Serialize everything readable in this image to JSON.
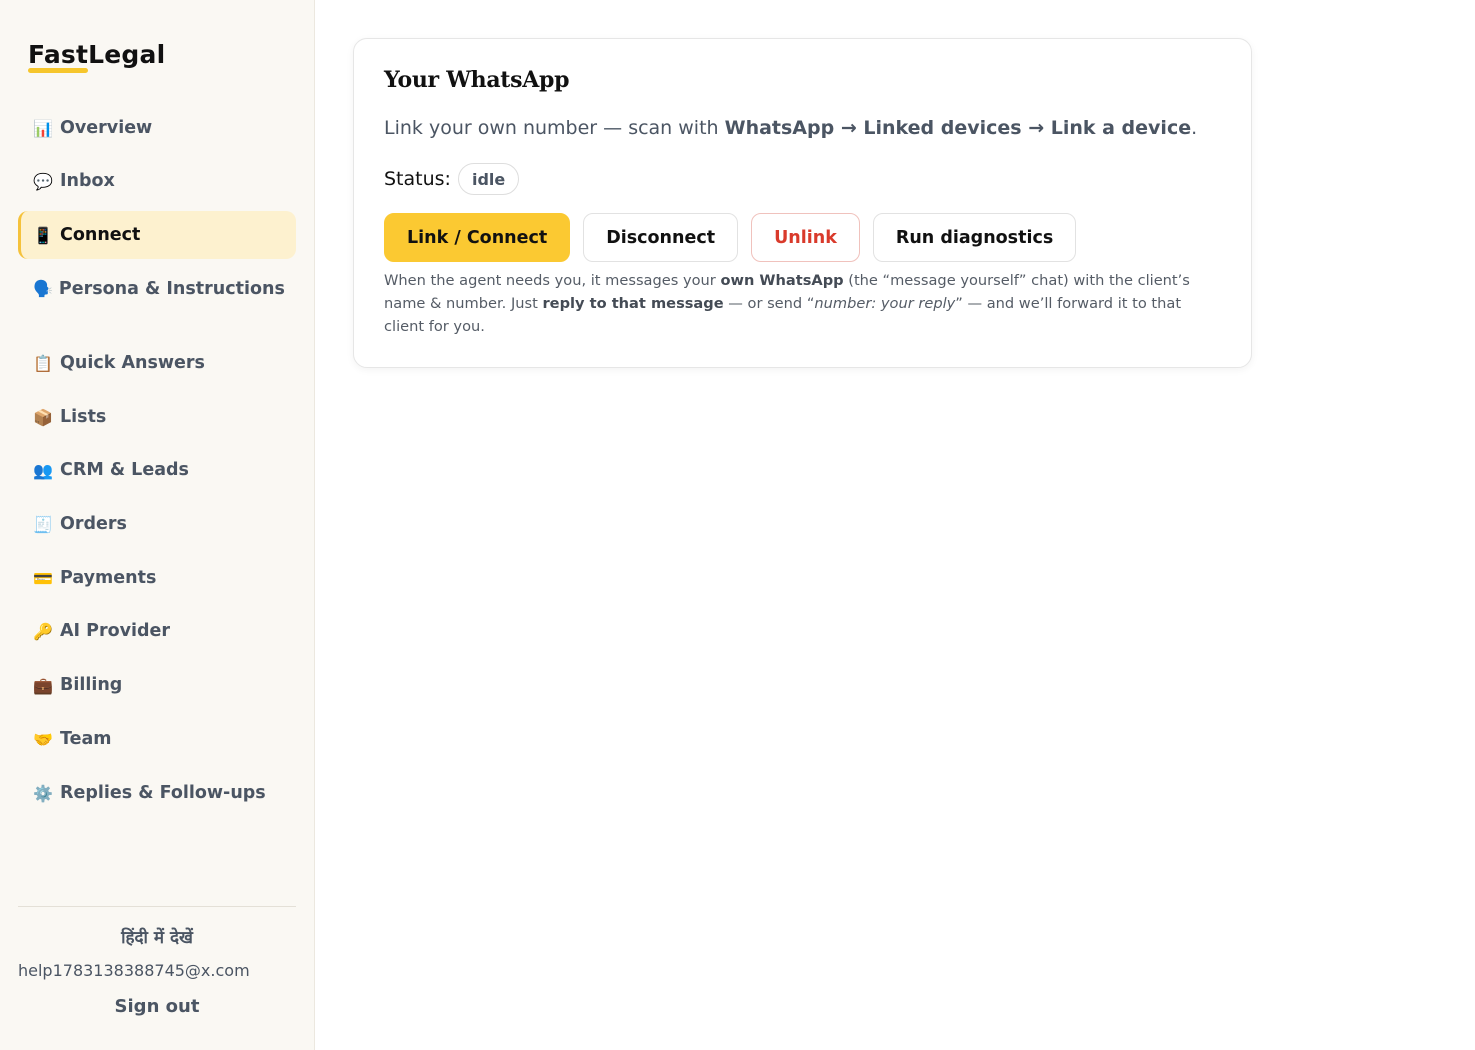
{
  "brand": {
    "name": "FastLegal"
  },
  "sidebar": {
    "items": [
      {
        "icon": "📊",
        "icon_name": "bar-chart-icon",
        "label": "Overview"
      },
      {
        "icon": "💬",
        "icon_name": "speech-bubble-icon",
        "label": "Inbox"
      },
      {
        "icon": "📱",
        "icon_name": "mobile-phone-icon",
        "label": "Connect",
        "active": true
      },
      {
        "icon": "🗣️",
        "icon_name": "speaking-head-icon",
        "label": "Persona & Instructions"
      },
      {
        "icon": "📋",
        "icon_name": "clipboard-icon",
        "label": "Quick Answers"
      },
      {
        "icon": "📦",
        "icon_name": "package-icon",
        "label": "Lists"
      },
      {
        "icon": "👥",
        "icon_name": "people-icon",
        "label": "CRM & Leads"
      },
      {
        "icon": "🧾",
        "icon_name": "receipt-icon",
        "label": "Orders"
      },
      {
        "icon": "💳",
        "icon_name": "credit-card-icon",
        "label": "Payments"
      },
      {
        "icon": "🔑",
        "icon_name": "key-icon",
        "label": "AI Provider"
      },
      {
        "icon": "💼",
        "icon_name": "briefcase-icon",
        "label": "Billing"
      },
      {
        "icon": "🤝",
        "icon_name": "handshake-icon",
        "label": "Team"
      },
      {
        "icon": "⚙️",
        "icon_name": "gear-icon",
        "label": "Replies & Follow-ups"
      }
    ],
    "language_link": "हिंदी में देखें",
    "user_email": "help1783138388745@x.com",
    "sign_out": "Sign out"
  },
  "card": {
    "title": "Your WhatsApp",
    "desc_prefix": "Link your own number — scan with ",
    "desc_bold": "WhatsApp → Linked devices → Link a device",
    "desc_suffix": ".",
    "status_label": "Status:",
    "status_value": "idle",
    "buttons": {
      "connect": "Link / Connect",
      "disconnect": "Disconnect",
      "unlink": "Unlink",
      "diagnostics": "Run diagnostics"
    },
    "help": {
      "p1": "When the agent needs you, it messages your ",
      "b1": "own WhatsApp",
      "p2": " (the “message yourself” chat) with the client’s name & number. Just ",
      "b2": "reply to that message",
      "p3": " — or send “",
      "i1": "number: your reply",
      "p4": "” — and we’ll forward it to that client for you."
    }
  },
  "colors": {
    "accent": "#fbc932",
    "active_bg": "#fdf1cf",
    "danger": "#d93a2b",
    "sidebar_bg": "#faf8f3"
  }
}
